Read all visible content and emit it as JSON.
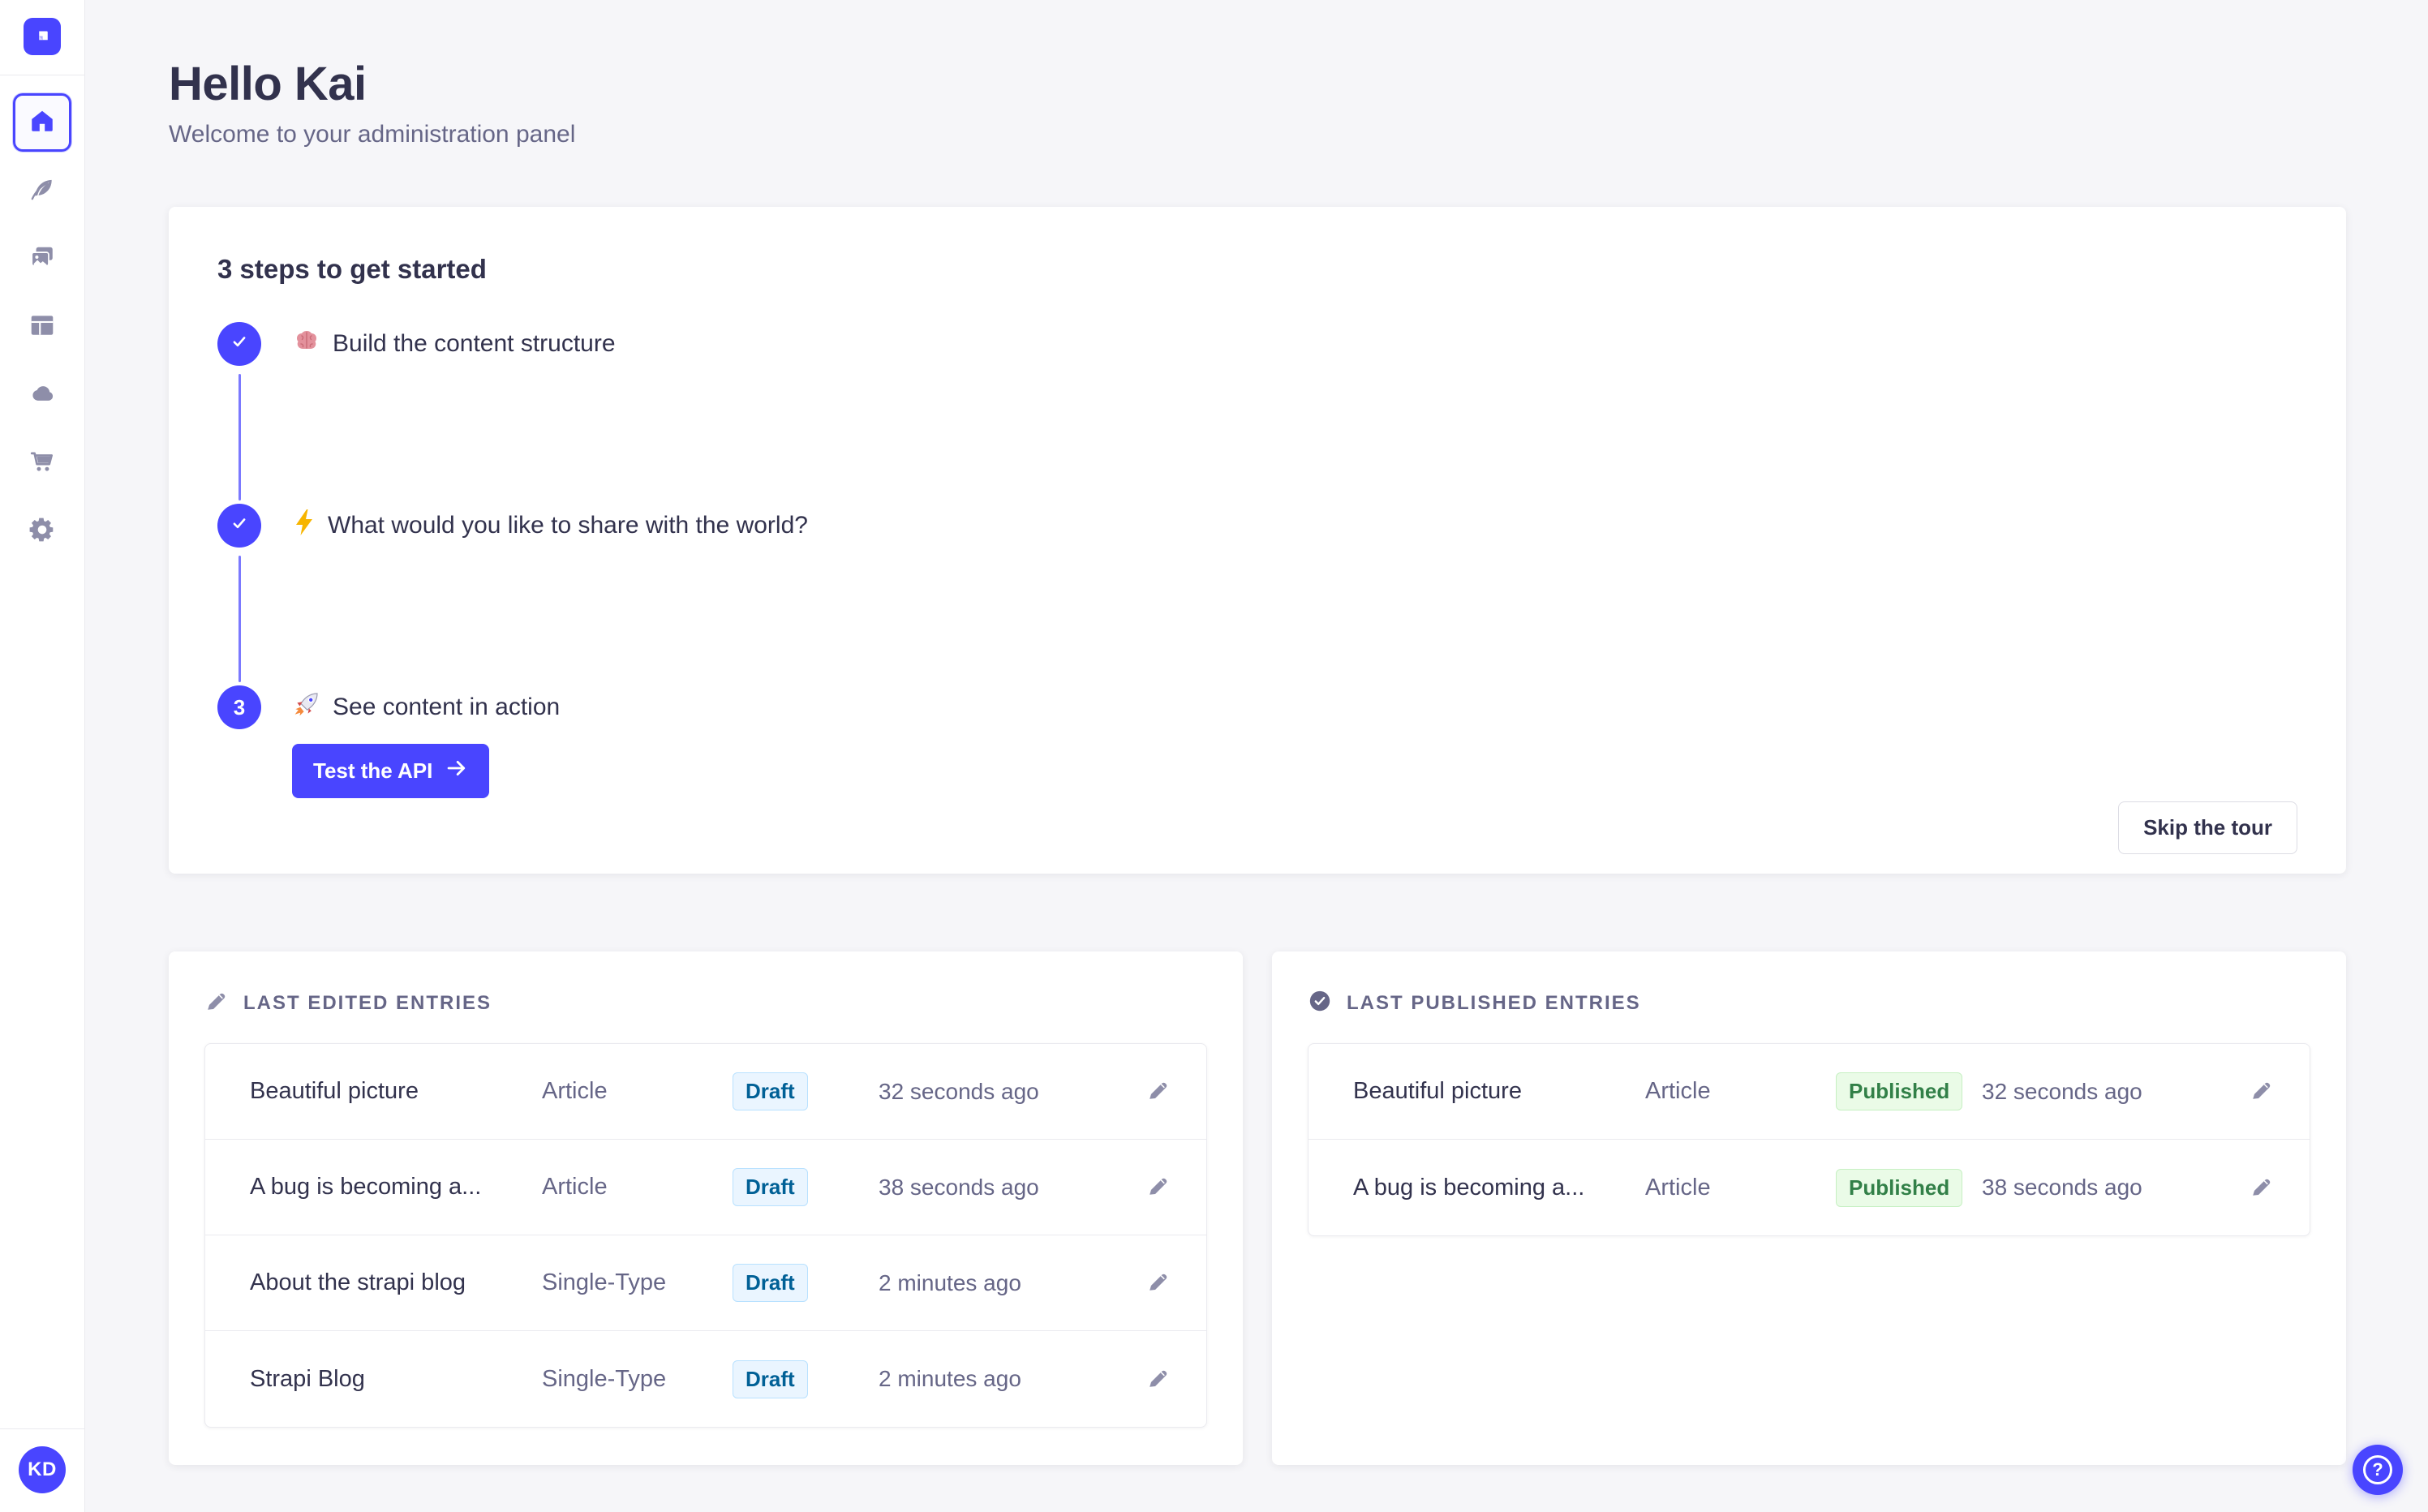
{
  "colors": {
    "accent": "#4945ff",
    "connector": "#7b79ff",
    "background": "#f6f6f9",
    "heading_text": "#32324d",
    "muted_text": "#666687",
    "sidebar_icon": "#8e8ea9",
    "draft_badge": {
      "bg": "#eaf5ff",
      "border": "#b8e1ff",
      "text": "#006096"
    },
    "published_badge": {
      "bg": "#eafbe7",
      "border": "#c6f0c2",
      "text": "#328048"
    }
  },
  "sidebar": {
    "logo_icon": "strapi-logo",
    "items": [
      {
        "id": "home",
        "icon": "home-icon",
        "active": true
      },
      {
        "id": "content-manager",
        "icon": "feather-icon",
        "active": false
      },
      {
        "id": "media-library",
        "icon": "media-library-icon",
        "active": false
      },
      {
        "id": "content-type-builder",
        "icon": "layout-icon",
        "active": false
      },
      {
        "id": "cloud",
        "icon": "cloud-icon",
        "active": false
      },
      {
        "id": "marketplace",
        "icon": "cart-icon",
        "active": false
      },
      {
        "id": "settings",
        "icon": "gear-icon",
        "active": false
      }
    ],
    "avatar_initials": "KD"
  },
  "header": {
    "title": "Hello Kai",
    "subtitle": "Welcome to your administration panel"
  },
  "onboarding": {
    "title": "3 steps to get started",
    "steps": [
      {
        "status": "done",
        "icon": "brain-icon",
        "label": "Build the content structure"
      },
      {
        "status": "done",
        "icon": "zap-icon",
        "label": "What would you like to share with the world?"
      },
      {
        "status": "current",
        "number": "3",
        "icon": "rocket-icon",
        "label": "See content in action",
        "cta": "Test the API"
      }
    ],
    "skip_label": "Skip the tour"
  },
  "last_edited": {
    "title": "LAST EDITED ENTRIES",
    "icon": "pencil-icon",
    "rows": [
      {
        "title": "Beautiful picture",
        "type": "Article",
        "status": "Draft",
        "time": "32 seconds ago"
      },
      {
        "title": "A bug is becoming a...",
        "type": "Article",
        "status": "Draft",
        "time": "38 seconds ago"
      },
      {
        "title": "About the strapi blog",
        "type": "Single-Type",
        "status": "Draft",
        "time": "2 minutes ago"
      },
      {
        "title": "Strapi Blog",
        "type": "Single-Type",
        "status": "Draft",
        "time": "2 minutes ago"
      }
    ]
  },
  "last_published": {
    "title": "LAST PUBLISHED ENTRIES",
    "icon": "check-circle-icon",
    "rows": [
      {
        "title": "Beautiful picture",
        "type": "Article",
        "status": "Published",
        "time": "32 seconds ago"
      },
      {
        "title": "A bug is becoming a...",
        "type": "Article",
        "status": "Published",
        "time": "38 seconds ago"
      }
    ]
  },
  "help": {
    "label": "?"
  }
}
